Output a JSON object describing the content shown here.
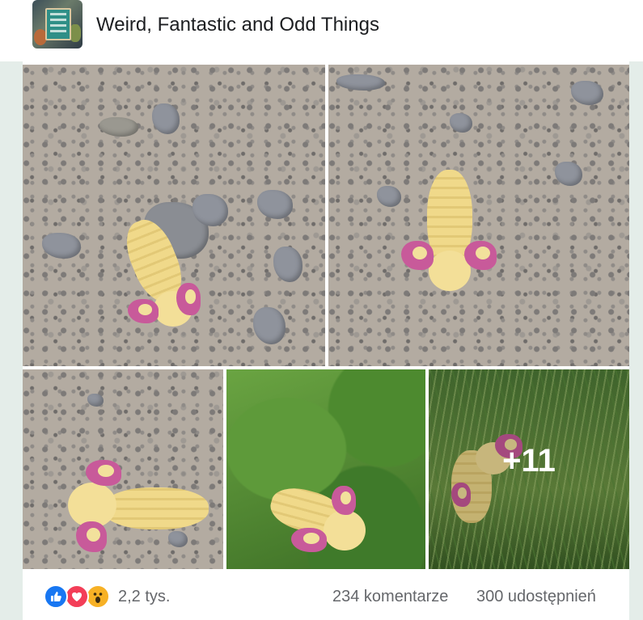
{
  "group": {
    "name": "Weird, Fantastic and Odd Things",
    "avatar_icon": "group-avatar"
  },
  "gallery": {
    "photos": [
      {
        "subject": "rosy maple moth on gravel"
      },
      {
        "subject": "rosy maple moth on gravel"
      },
      {
        "subject": "rosy maple moth on gravel"
      },
      {
        "subject": "rosy maple moth on leaf"
      },
      {
        "subject": "rosy maple moth in grass"
      }
    ],
    "more_count": "+11"
  },
  "footer": {
    "reactions": [
      "like-icon",
      "love-icon",
      "wow-icon"
    ],
    "reaction_count": "2,2 tys.",
    "comments": "234 komentarze",
    "shares": "300 udostępnień"
  },
  "colors": {
    "like": "#1877f2",
    "love": "#f33e58",
    "wow": "#f7b125",
    "moth_body": "#f0d98a",
    "moth_wing": "#c85a9a"
  }
}
